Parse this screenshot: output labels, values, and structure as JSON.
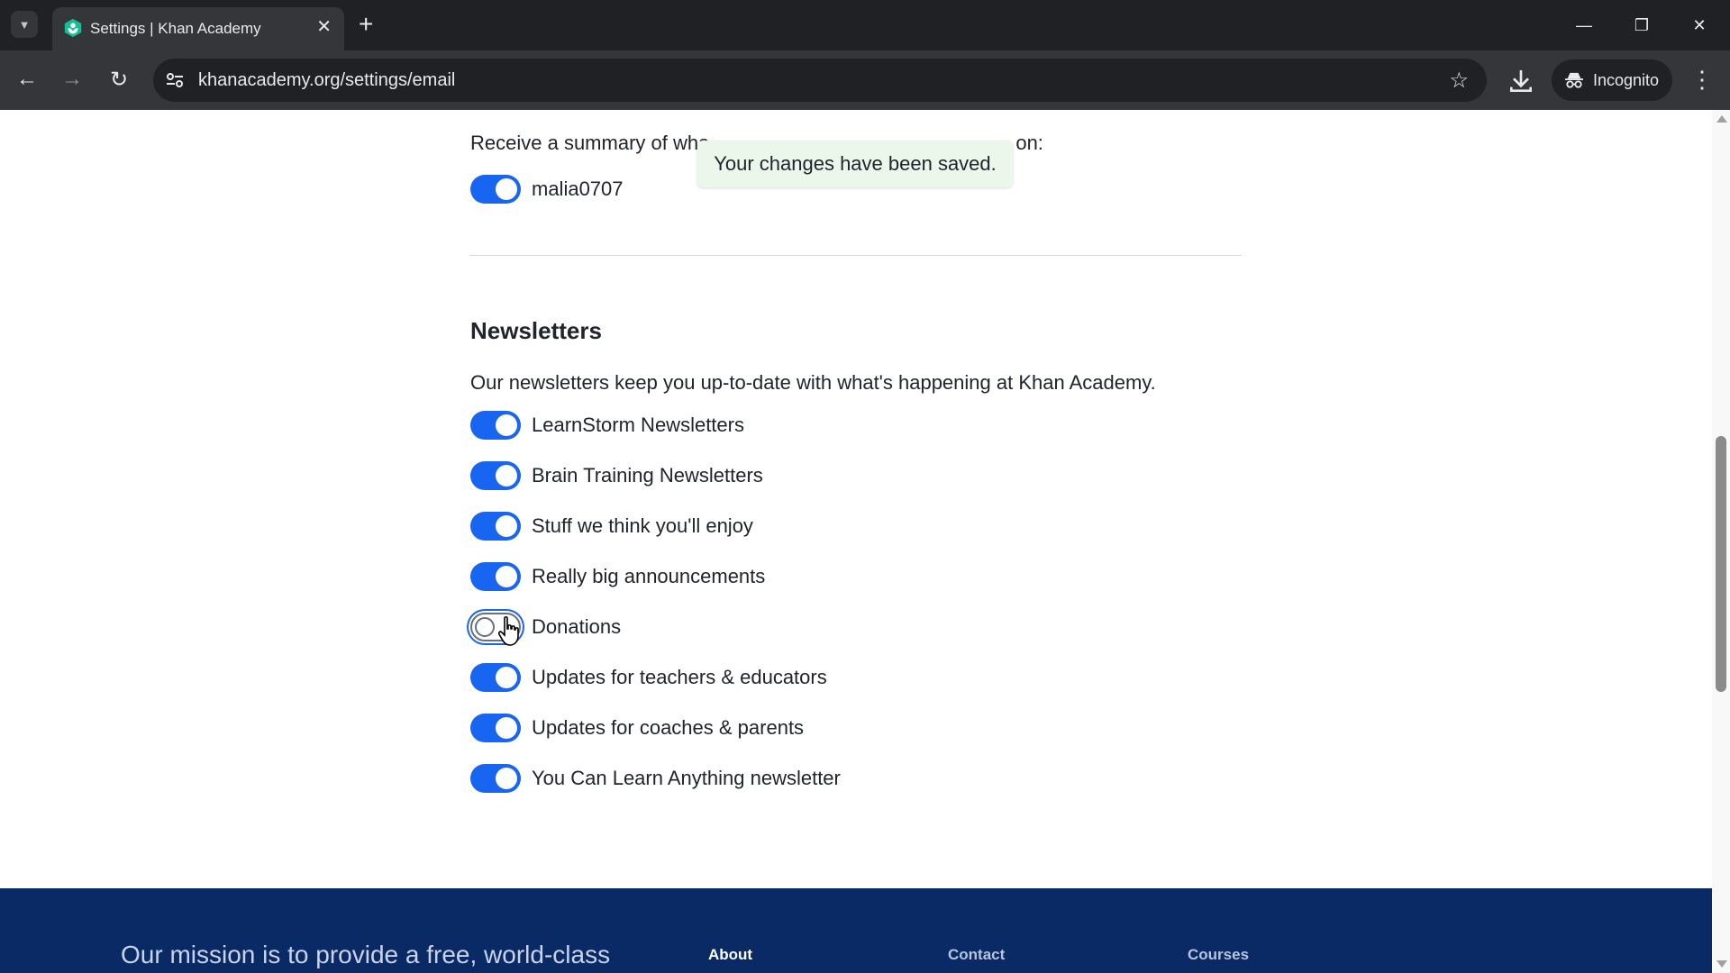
{
  "browser": {
    "tab_title": "Settings | Khan Academy",
    "url": "khanacademy.org/settings/email",
    "incognito_label": "Incognito"
  },
  "notice": {
    "summary_prefix": "Receive a summary of wha",
    "summary_suffix": "on:",
    "toast": "Your changes have been saved."
  },
  "child_summary": {
    "username": "malia0707",
    "enabled": true
  },
  "newsletters": {
    "title": "Newsletters",
    "description": "Our newsletters keep you up-to-date with what's happening at Khan Academy.",
    "items": [
      {
        "label": "LearnStorm Newsletters",
        "enabled": true
      },
      {
        "label": "Brain Training Newsletters",
        "enabled": true
      },
      {
        "label": "Stuff we think you'll enjoy",
        "enabled": true
      },
      {
        "label": "Really big announcements",
        "enabled": true
      },
      {
        "label": "Donations",
        "enabled": false
      },
      {
        "label": "Updates for teachers & educators",
        "enabled": true
      },
      {
        "label": "Updates for coaches & parents",
        "enabled": true
      },
      {
        "label": "You Can Learn Anything newsletter",
        "enabled": true
      }
    ]
  },
  "footer": {
    "mission": "Our mission is to provide a free, world-class",
    "columns": [
      {
        "label": "About",
        "color": "#ffffff"
      },
      {
        "label": "Contact",
        "color": "#b8c3dc"
      },
      {
        "label": "Courses",
        "color": "#b8c3dc"
      }
    ]
  },
  "colors": {
    "accent": "#1865f2",
    "footer_bg": "#0a2a66",
    "toast_bg": "#ecf7ec"
  }
}
